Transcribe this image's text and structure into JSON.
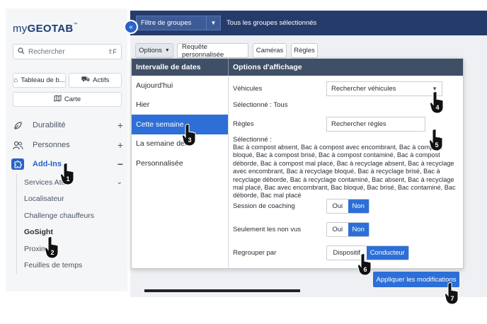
{
  "sidebar": {
    "logo_prefix": "my",
    "logo_main": "GEOTAB",
    "logo_tm": "™",
    "search": {
      "placeholder": "Rechercher",
      "shortcut": "⇧F"
    },
    "buttons": {
      "tableau": "Tableau de b...",
      "actifs": "Actifs",
      "carte": "Carte"
    },
    "nav": [
      {
        "label": "Durabilité",
        "icon": "leaf-icon",
        "action": "+"
      },
      {
        "label": "Personnes",
        "icon": "people-icon",
        "action": "+"
      },
      {
        "label": "Add-Ins",
        "icon": "puzzle-icon",
        "action": "−"
      }
    ],
    "submenu": [
      {
        "label": "Services Attr"
      },
      {
        "label": "Localisateur"
      },
      {
        "label": "Challenge chauffeurs"
      },
      {
        "label": "GoSight"
      },
      {
        "label": "Proxim"
      },
      {
        "label": "Feuilles de temps"
      }
    ],
    "collapse_glyph": "«"
  },
  "topbar": {
    "group_filter": "Filtre de groupes",
    "group_status": "Tous les groupes sélectionnés"
  },
  "toolbar": {
    "options": "Options",
    "requete": "Requête personnalisée",
    "cameras": "Caméras",
    "regles": "Règles"
  },
  "panel": {
    "date_header": "Intervalle de dates",
    "options_header": "Options d'affichage",
    "dates": [
      "Aujourd'hui",
      "Hier",
      "Cette semaine",
      "La semaine der",
      "Personnalisée"
    ],
    "selected_date": "Cette semaine",
    "vehicles_label": "Véhicules",
    "vehicles_placeholder": "Rechercher véhicules",
    "vehicles_selected": "Sélectionné : Tous",
    "rules_label": "Règles",
    "rules_placeholder": "Rechercher règles",
    "rules_selected_label": "Sélectionné :",
    "rules_selected": "Bac à compost absent, Bac à compost avec encombrant, Bac à compost bloqué, Bac à compost brisé, Bac à compost contaminé, Bac à compost déborde, Bac à compost mal placé, Bac à recyclage absent, Bac à recyclage avec encombrant, Bac à recyclage bloqué, Bac à recyclage brisé, Bac à recyclage déborde, Bac à recyclage contaminé, Bac absent, Bac à recyclage mal placé, Bac avec encombrant, Bac bloqué, Bac brisé, Bac contaminé, Bac déborde, Bac mal placé",
    "coaching_label": "Session de coaching",
    "unseen_label": "Seulement les non vus",
    "group_by_label": "Regrouper par",
    "yes": "Oui",
    "no": "Non",
    "group_device": "Dispositif",
    "group_driver": "Conducteur",
    "apply": "Appliquer les modifications"
  },
  "markers": [
    "1",
    "2",
    "3",
    "4",
    "5",
    "6",
    "7"
  ],
  "colors": {
    "brand_navy": "#253c6b",
    "accent_blue": "#2d6fd6",
    "panel_header": "#3f4f66"
  }
}
